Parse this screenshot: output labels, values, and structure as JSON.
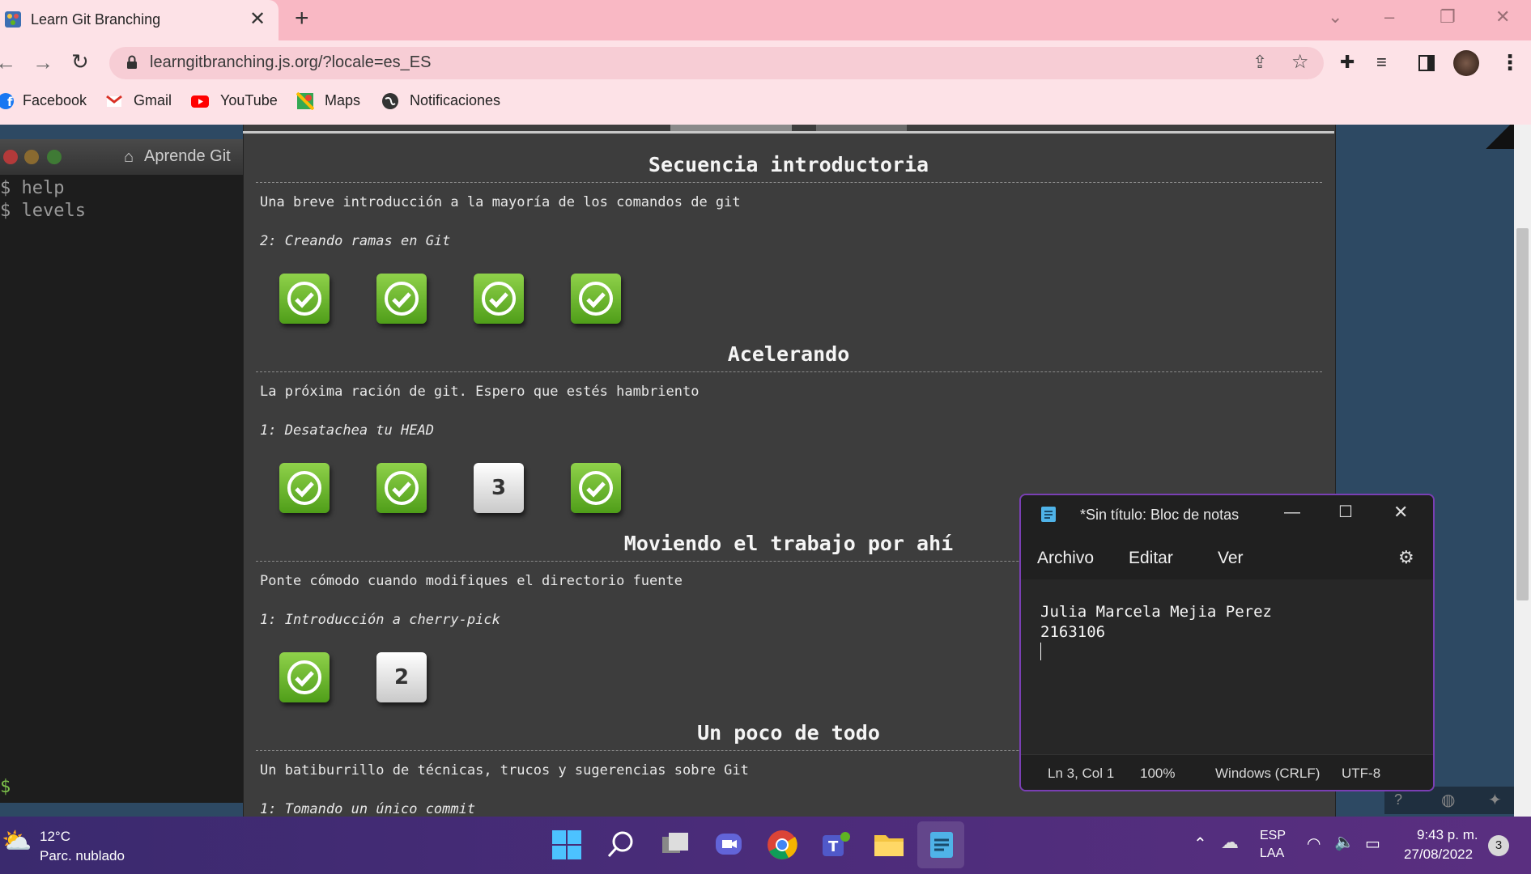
{
  "browser": {
    "tab_title": "Learn Git Branching",
    "tab_close": "✕",
    "new_tab": "+",
    "url": "learngitbranching.js.org/?locale=es_ES",
    "bookmarks": [
      "Facebook",
      "Gmail",
      "YouTube",
      "Maps",
      "Notificaciones"
    ]
  },
  "terminal": {
    "title": "Aprende Git",
    "lines": [
      "$ help",
      "$ levels"
    ],
    "prompt": "$"
  },
  "sections": [
    {
      "title": "Secuencia introductoria",
      "description": "Una breve introducción a la mayoría de los comandos de git",
      "level": "2: Creando ramas en Git",
      "levels": [
        "done",
        "done",
        "done",
        "done"
      ]
    },
    {
      "title": "Acelerando",
      "description": "La próxima ración de git. Espero que estés hambriento",
      "level": "1: Desatachea tu HEAD",
      "levels": [
        "done",
        "done",
        "3",
        "done"
      ]
    },
    {
      "title": "Moviendo el trabajo por ahí",
      "description": "Ponte cómodo cuando modifiques el directorio fuente",
      "level": "1: Introducción a cherry-pick",
      "levels": [
        "done",
        "2"
      ]
    },
    {
      "title": "Un poco de todo",
      "description": "Un batiburrillo de técnicas, trucos y sugerencias sobre Git",
      "level": "1: Tomando un único commit"
    }
  ],
  "notepad": {
    "title": "*Sin título: Bloc de notas",
    "menus": [
      "Archivo",
      "Editar",
      "Ver"
    ],
    "text_line1": "Julia Marcela Mejia Perez",
    "text_line2": "2163106",
    "status": [
      "Ln 3, Col 1",
      "100%",
      "Windows (CRLF)",
      "UTF-8"
    ]
  },
  "taskbar": {
    "weather_temp": "12°C",
    "weather_desc": "Parc. nublado",
    "lang_top": "ESP",
    "lang_bottom": "LAA",
    "time": "9:43 p. m.",
    "date": "27/08/2022",
    "notification_count": "3"
  },
  "colors": {
    "done_green": "#5fb322",
    "notepad_border": "#7a3fb4",
    "tabbar": "#f9b8c4"
  }
}
